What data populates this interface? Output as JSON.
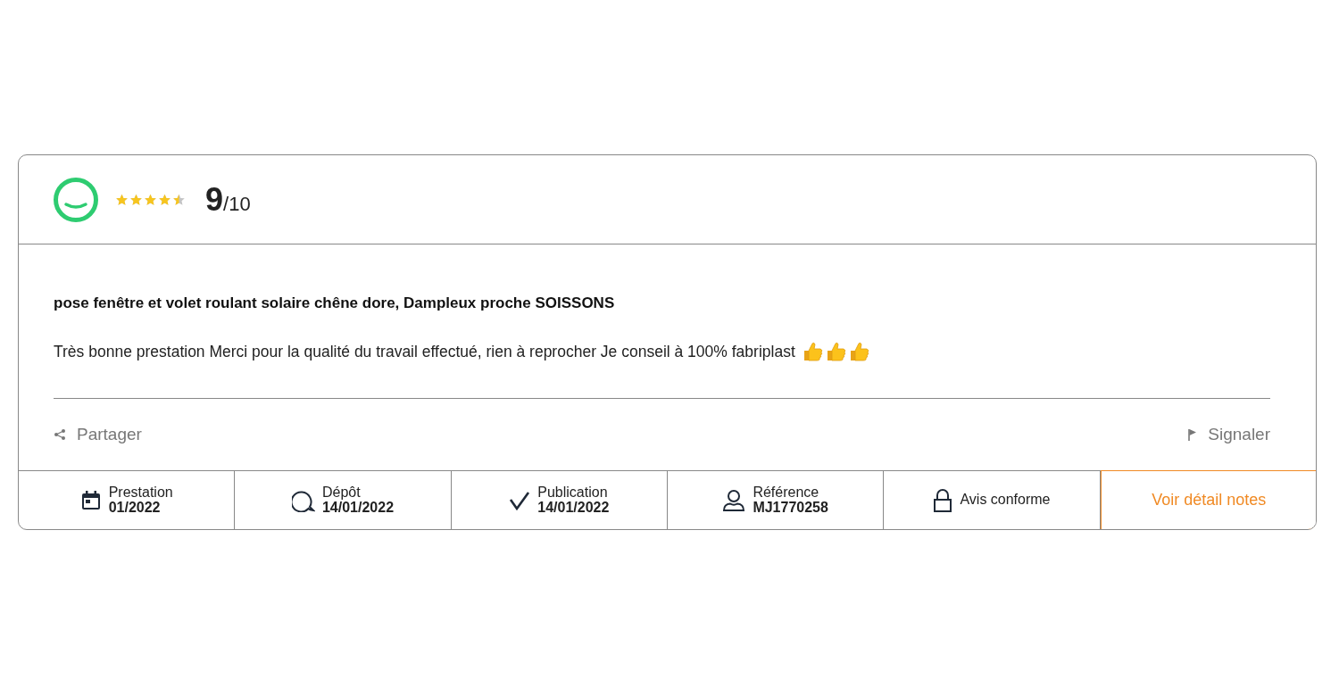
{
  "review": {
    "stars": 4.5,
    "score": "9",
    "scale": "/10",
    "title": "pose fenêtre et volet roulant solaire chêne dore, Dampleux proche SOISSONS",
    "text": "Très bonne prestation Merci pour la qualité du travail effectué, rien à reprocher Je conseil à 100% fabriplast"
  },
  "actions": {
    "share": "Partager",
    "report": "Signaler"
  },
  "footer": [
    {
      "kind": "info",
      "label": "Prestation",
      "value": "01/2022"
    },
    {
      "kind": "info",
      "label": "Dépôt",
      "value": "14/01/2022"
    },
    {
      "kind": "info",
      "label": "Publication",
      "value": "14/01/2022"
    },
    {
      "kind": "info",
      "label": "Référence",
      "value": "MJ1770258"
    },
    {
      "kind": "info",
      "label": "Avis conforme"
    },
    {
      "kind": "link",
      "label": "Voir détail notes"
    }
  ]
}
